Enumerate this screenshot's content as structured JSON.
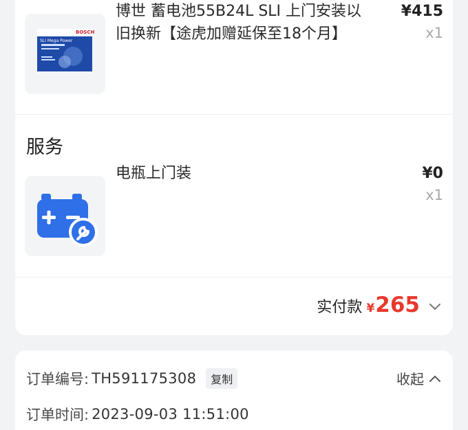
{
  "goods": [
    {
      "title": "博世 蓄电池55B24L SLI 上门安装以旧换新【途虎加赠延保至18个月】",
      "price": "¥415",
      "qty": "x1",
      "thumb_label": "BOSCH",
      "thumb_subtitle": "SLI Mega Power"
    }
  ],
  "service_section": {
    "title": "服务",
    "items": [
      {
        "title": "电瓶上门装",
        "price": "¥0",
        "qty": "x1",
        "icon": "battery-wrench-icon"
      }
    ]
  },
  "payment": {
    "label": "实付款",
    "currency": "¥",
    "amount": "265",
    "expand_icon": "chevron-down-icon"
  },
  "order": {
    "number_label": "订单编号:",
    "number": "TH591175308",
    "copy_label": "复制",
    "collapse_label": "收起",
    "collapse_icon": "chevron-up-icon",
    "time_label": "订单时间:",
    "time": "2023-09-03 11:51:00"
  },
  "colors": {
    "price_red": "#e8382c",
    "icon_blue": "#2f6fe8",
    "background": "#f2f3f5"
  }
}
